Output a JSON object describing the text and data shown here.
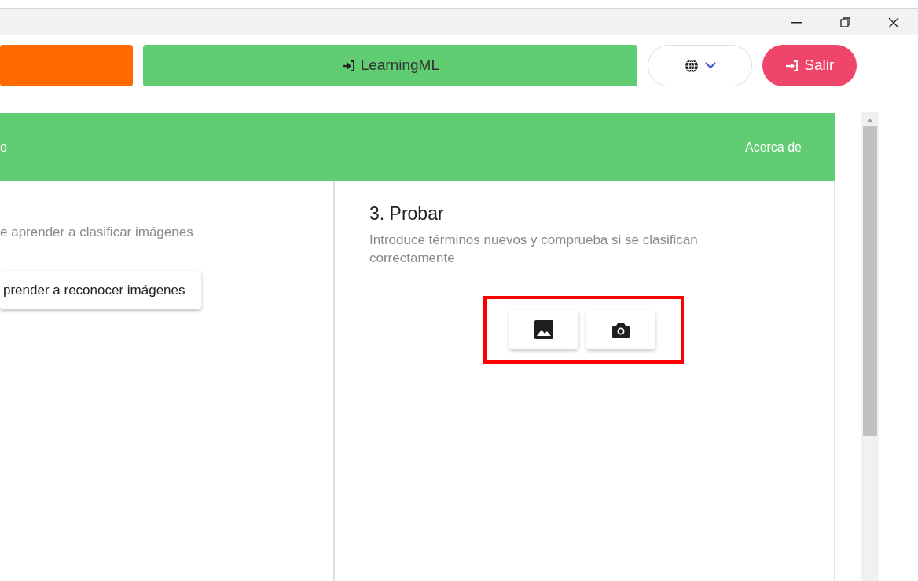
{
  "header": {
    "buttons": [
      {
        "kind": "blank"
      },
      {
        "kind": "project",
        "label": "LearningML"
      },
      {
        "kind": "language"
      },
      {
        "kind": "logout",
        "label": "Salir"
      }
    ]
  },
  "nav": {
    "items": [
      {
        "label": "o"
      },
      {
        "label": "Acerca de"
      }
    ]
  },
  "left_panel": {
    "description": "e aprender a clasificar imágenes",
    "button": "prender a reconocer imágenes"
  },
  "right_panel": {
    "title": "3. Probar",
    "description": "Introduce términos nuevos y comprueba si se clasifican correctamente",
    "highlighted": true,
    "actions": [
      {
        "kind": "image"
      },
      {
        "kind": "camera"
      }
    ]
  }
}
